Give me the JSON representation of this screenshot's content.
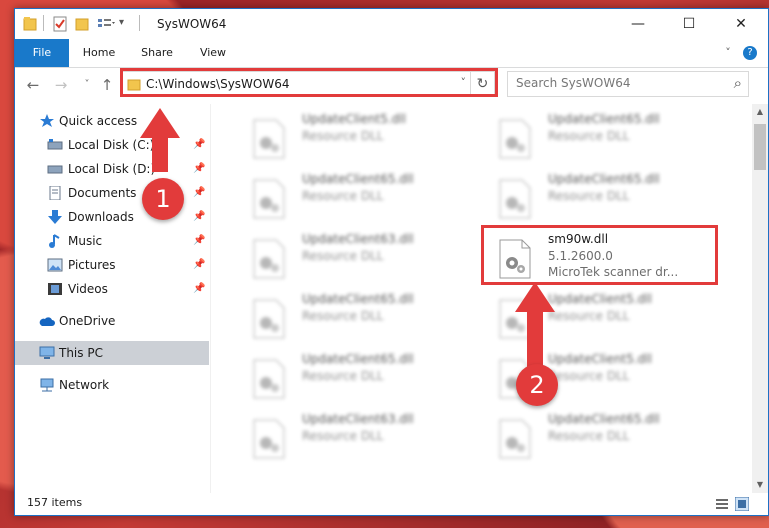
{
  "window": {
    "title": "SysWOW64",
    "controls": {
      "minimize": "—",
      "maximize": "☐",
      "close": "✕"
    }
  },
  "ribbon": {
    "tabs": [
      {
        "label": "File"
      },
      {
        "label": "Home"
      },
      {
        "label": "Share"
      },
      {
        "label": "View"
      }
    ],
    "help": "?"
  },
  "navigation": {
    "back": "←",
    "forward": "→",
    "recent": "˅",
    "up": "↑",
    "address": "C:\\Windows\\SysWOW64",
    "dropdown": "˅",
    "refresh": "↻",
    "search_placeholder": "Search SysWOW64",
    "search_icon": "⌕"
  },
  "sidebar": {
    "items": [
      {
        "label": "Quick access",
        "icon": "star-icon"
      },
      {
        "label": "Local Disk (C:)",
        "icon": "drive-icon",
        "pinned": true
      },
      {
        "label": "Local Disk (D:)",
        "icon": "drive-icon",
        "pinned": true
      },
      {
        "label": "Documents",
        "icon": "documents-icon",
        "pinned": true
      },
      {
        "label": "Downloads",
        "icon": "download-icon",
        "pinned": true
      },
      {
        "label": "Music",
        "icon": "music-icon",
        "pinned": true
      },
      {
        "label": "Pictures",
        "icon": "pictures-icon",
        "pinned": true
      },
      {
        "label": "Videos",
        "icon": "videos-icon",
        "pinned": true
      },
      {
        "label": "OneDrive",
        "icon": "cloud-icon"
      },
      {
        "label": "This PC",
        "icon": "computer-icon",
        "selected": true
      },
      {
        "label": "Network",
        "icon": "network-icon"
      }
    ],
    "pin_glyph": "📌"
  },
  "files": {
    "left_column": [
      {
        "name": "UpdateClient5.dll",
        "type": "Resource DLL"
      },
      {
        "name": "UpdateClient65.dll",
        "type": "Resource DLL"
      },
      {
        "name": "UpdateClient63.dll",
        "type": "Resource DLL"
      },
      {
        "name": "UpdateClient65.dll",
        "type": "Resource DLL"
      },
      {
        "name": "UpdateClient65.dll",
        "type": "Resource DLL"
      },
      {
        "name": "UpdateClient63.dll",
        "type": "Resource DLL"
      }
    ],
    "right_column": [
      {
        "name": "UpdateClient65.dll",
        "type": "Resource DLL"
      },
      {
        "name": "UpdateClient65.dll",
        "type": "Resource DLL"
      },
      {
        "name": "sm90w.dll",
        "version": "5.1.2600.0",
        "description": "MicroTek scanner dr..."
      },
      {
        "name": "UpdateClient5.dll",
        "type": "Resource DLL"
      },
      {
        "name": "UpdateClient5.dll",
        "type": "Resource DLL"
      },
      {
        "name": "UpdateClient65.dll",
        "type": "Resource DLL"
      }
    ]
  },
  "status": {
    "item_count": "157 items"
  },
  "annotations": {
    "step1": "1",
    "step2": "2",
    "color": "#e23b3b"
  }
}
